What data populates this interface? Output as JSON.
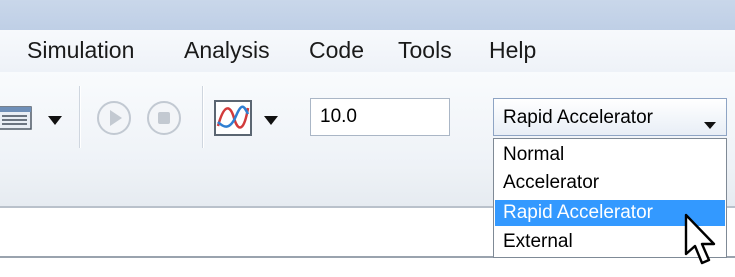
{
  "menubar": {
    "items": [
      "Simulation",
      "Analysis",
      "Code",
      "Tools",
      "Help"
    ]
  },
  "toolbar": {
    "stop_time_value": "10.0",
    "simulation_mode": {
      "selected": "Rapid Accelerator",
      "options": [
        "Normal",
        "Accelerator",
        "Rapid Accelerator",
        "External"
      ],
      "highlighted_index": 2
    }
  },
  "icons": {
    "library_browser": "library-browser-icon",
    "dropdown_arrow": "triangle-down-icon",
    "run": "play-icon",
    "stop": "stop-icon",
    "data_inspector": "signal-plot-icon",
    "cursor": "mouse-pointer-icon"
  },
  "colors": {
    "selection_highlight": "#3399ff",
    "menubar_background": "#f3f6fa",
    "titlebar_background": "#c5d4e8"
  }
}
